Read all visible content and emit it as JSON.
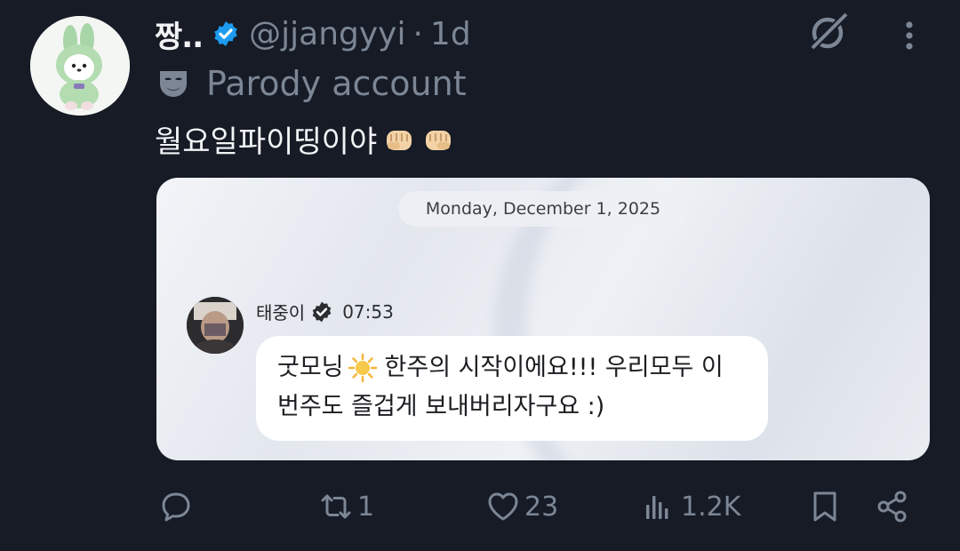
{
  "tweet": {
    "display_name": "짱..",
    "handle": "@jjangyyi",
    "separator": "·",
    "time": "1d",
    "parody_label": "Parody account",
    "text": "월요일파이띵이야",
    "emoji": [
      "fist-icon",
      "fist-icon"
    ]
  },
  "media": {
    "date_chip": "Monday, December 1, 2025",
    "sender_name": "태중이",
    "sender_time": "07:53",
    "message_line1_a": "굿모닝",
    "message_line1_b": "한주의 시작이에요!!! 우리모두 이",
    "message_line2": "번주도 즐겁게 보내버리자구요 :)"
  },
  "actions": {
    "replies": "",
    "reposts": "1",
    "likes": "23",
    "views": "1.2K"
  },
  "colors": {
    "background": "#161b26",
    "primary_text": "#f1f3f5",
    "secondary_text": "#7c8694",
    "verified_blue": "#1d9bf0"
  }
}
